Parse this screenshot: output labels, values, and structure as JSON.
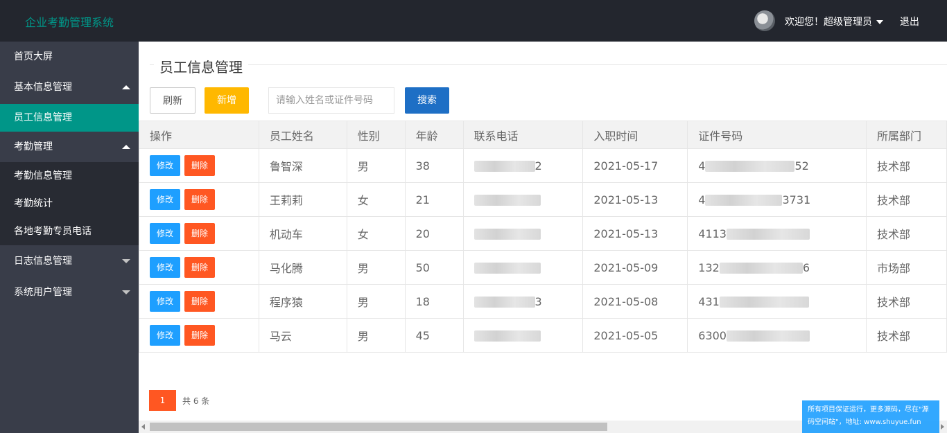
{
  "header": {
    "logo": "企业考勤管理系统",
    "welcome": "欢迎您！超级管理员",
    "logout": "退出"
  },
  "sidebar": {
    "items": [
      {
        "label": "首页大屏"
      },
      {
        "label": "基本信息管理"
      },
      {
        "label": "员工信息管理"
      },
      {
        "label": "考勤管理"
      },
      {
        "label": "考勤信息管理"
      },
      {
        "label": "考勤统计"
      },
      {
        "label": "各地考勤专员电话"
      },
      {
        "label": "日志信息管理"
      },
      {
        "label": "系统用户管理"
      }
    ]
  },
  "main": {
    "legend": "员工信息管理",
    "toolbar": {
      "refresh": "刷新",
      "add": "新增",
      "search_placeholder": "请输入姓名或证件号码",
      "search": "搜索"
    },
    "table": {
      "columns": [
        "操作",
        "员工姓名",
        "性别",
        "年龄",
        "联系电话",
        "入职时间",
        "证件号码",
        "所属部门"
      ],
      "edit_label": "修改",
      "delete_label": "删除",
      "rows": [
        {
          "name": "鲁智深",
          "gender": "男",
          "age": "38",
          "phone_tail": "2",
          "date": "2021-05-17",
          "id_head": "4",
          "id_tail": "52",
          "dept": "技术部"
        },
        {
          "name": "王莉莉",
          "gender": "女",
          "age": "21",
          "phone_tail": "",
          "date": "2021-05-13",
          "id_head": "4",
          "id_tail": "3731",
          "dept": "技术部"
        },
        {
          "name": "机动车",
          "gender": "女",
          "age": "20",
          "phone_tail": "",
          "date": "2021-05-13",
          "id_head": "4113",
          "id_tail": "",
          "dept": "技术部"
        },
        {
          "name": "马化腾",
          "gender": "男",
          "age": "50",
          "phone_tail": "",
          "date": "2021-05-09",
          "id_head": "132",
          "id_tail": "6",
          "dept": "市场部"
        },
        {
          "name": "程序猿",
          "gender": "男",
          "age": "18",
          "phone_tail": "3",
          "date": "2021-05-08",
          "id_head": "431",
          "id_tail": "",
          "dept": "技术部"
        },
        {
          "name": "马云",
          "gender": "男",
          "age": "45",
          "phone_tail": "",
          "date": "2021-05-05",
          "id_head": "6300",
          "id_tail": "",
          "dept": "技术部"
        }
      ]
    },
    "pager": {
      "current": "1",
      "total": "共 6 条"
    }
  },
  "notice": "所有项目保证运行，更多源码，尽在\"源码空间站\"，地址: www.shuyue.fun",
  "colors": {
    "header": "#23262e",
    "sidebar": "#393d49",
    "accent": "#009688",
    "edit": "#1e9fff",
    "delete": "#ff5722",
    "add": "#ffb800",
    "search": "#1e6fc5"
  }
}
